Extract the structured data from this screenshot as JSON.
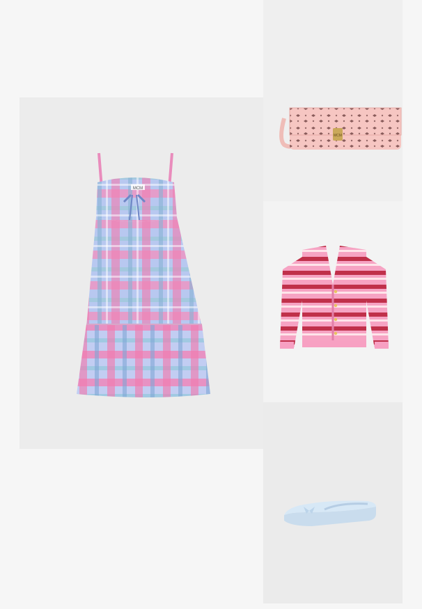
{
  "products": [
    {
      "id": "dress",
      "icon": "plaid-dress-icon",
      "label": "MCM"
    },
    {
      "id": "bag",
      "icon": "pink-monogram-crossbody-bag-icon",
      "brand_text": "MCM"
    },
    {
      "id": "cardigan",
      "icon": "pink-striped-cardigan-icon"
    },
    {
      "id": "shoe",
      "icon": "light-blue-ballet-flat-icon"
    }
  ],
  "colors": {
    "page_bg": "#f6f6f6",
    "dress_pink": "#f08ab8",
    "dress_blue": "#9fb6ea",
    "bag_pink": "#f4c3c0",
    "cardigan_pink": "#f7a0c2",
    "cardigan_red": "#c0304a",
    "shoe_blue": "#cfe3f3"
  }
}
